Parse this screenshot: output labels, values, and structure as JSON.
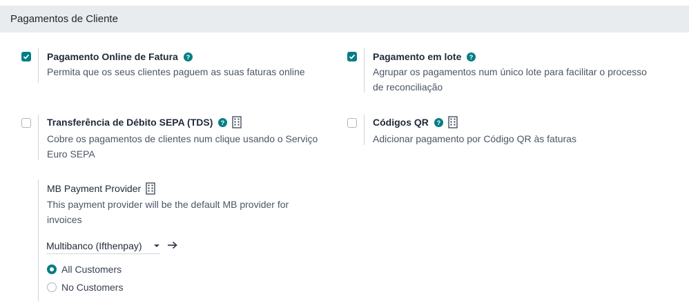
{
  "section": {
    "title": "Pagamentos de Cliente"
  },
  "settings": {
    "online_invoice": {
      "checked": true,
      "title": "Pagamento Online de Fatura",
      "description": "Permita que os seus clientes paguem as suas faturas online"
    },
    "batch_payment": {
      "checked": true,
      "title": "Pagamento em lote",
      "description_line1": "Agrupar os pagamentos num único lote para facilitar o processo",
      "description_line2": "de reconciliação"
    },
    "sepa_debit": {
      "checked": false,
      "title": "Transferência de Débito SEPA (TDS)",
      "description_line1": "Cobre os pagamentos de clientes num clique usando o Serviço",
      "description_line2": "Euro SEPA"
    },
    "qr_codes": {
      "checked": false,
      "title": "Códigos QR",
      "description": "Adicionar pagamento por Código QR às faturas"
    },
    "mb_provider": {
      "title": "MB Payment Provider",
      "description_line1": "This payment provider will be the default MB provider for",
      "description_line2": "invoices",
      "selected_provider": "Multibanco (Ifthenpay)",
      "radio_options": [
        {
          "label": "All Customers",
          "selected": true
        },
        {
          "label": "No Customers",
          "selected": false
        }
      ]
    }
  },
  "colors": {
    "accent": "#017e84",
    "header_bg": "#e9ecef"
  }
}
